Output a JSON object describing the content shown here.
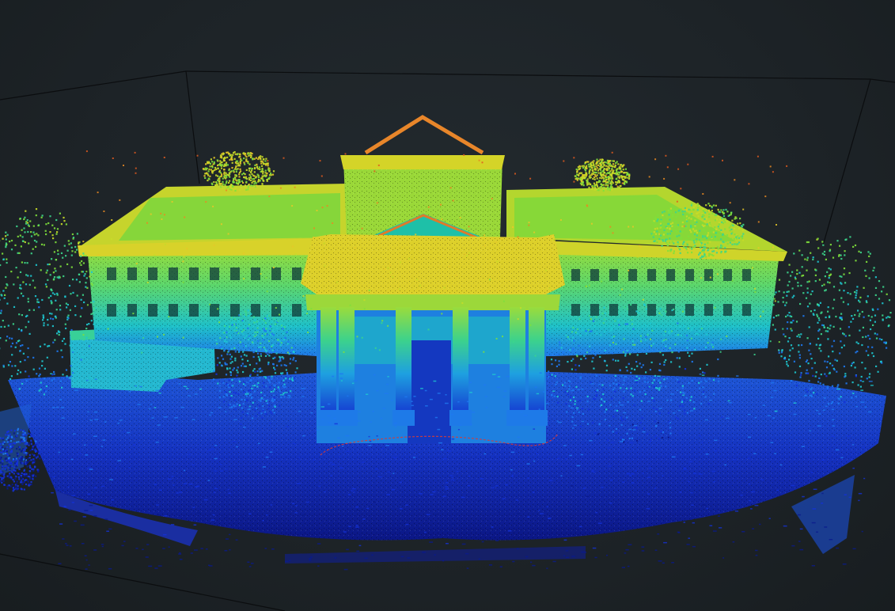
{
  "viewer": {
    "background_color": "#1c2226",
    "grid_color": "#0b0d0f",
    "colormap": [
      "#0a1a8c",
      "#1432d8",
      "#1e78f0",
      "#1ec8d0",
      "#3cd68c",
      "#7ee03c",
      "#c8dc28",
      "#e6c828",
      "#e88a22",
      "#e05a1e"
    ],
    "colormap_name": "height (jet)",
    "trajectory_color": "#d23c3c"
  }
}
